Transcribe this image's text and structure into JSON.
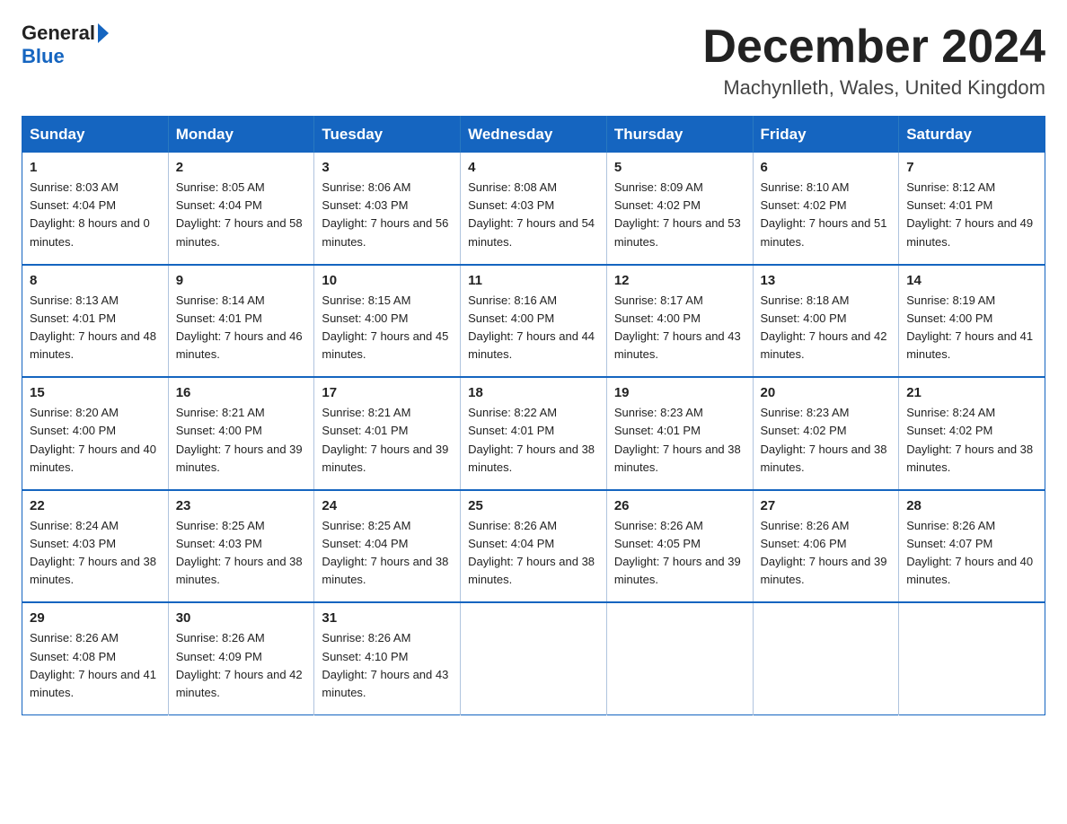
{
  "logo": {
    "general": "General",
    "blue": "Blue"
  },
  "title": "December 2024",
  "location": "Machynlleth, Wales, United Kingdom",
  "days_of_week": [
    "Sunday",
    "Monday",
    "Tuesday",
    "Wednesday",
    "Thursday",
    "Friday",
    "Saturday"
  ],
  "weeks": [
    [
      {
        "day": "1",
        "sunrise": "8:03 AM",
        "sunset": "4:04 PM",
        "daylight": "8 hours and 0 minutes."
      },
      {
        "day": "2",
        "sunrise": "8:05 AM",
        "sunset": "4:04 PM",
        "daylight": "7 hours and 58 minutes."
      },
      {
        "day": "3",
        "sunrise": "8:06 AM",
        "sunset": "4:03 PM",
        "daylight": "7 hours and 56 minutes."
      },
      {
        "day": "4",
        "sunrise": "8:08 AM",
        "sunset": "4:03 PM",
        "daylight": "7 hours and 54 minutes."
      },
      {
        "day": "5",
        "sunrise": "8:09 AM",
        "sunset": "4:02 PM",
        "daylight": "7 hours and 53 minutes."
      },
      {
        "day": "6",
        "sunrise": "8:10 AM",
        "sunset": "4:02 PM",
        "daylight": "7 hours and 51 minutes."
      },
      {
        "day": "7",
        "sunrise": "8:12 AM",
        "sunset": "4:01 PM",
        "daylight": "7 hours and 49 minutes."
      }
    ],
    [
      {
        "day": "8",
        "sunrise": "8:13 AM",
        "sunset": "4:01 PM",
        "daylight": "7 hours and 48 minutes."
      },
      {
        "day": "9",
        "sunrise": "8:14 AM",
        "sunset": "4:01 PM",
        "daylight": "7 hours and 46 minutes."
      },
      {
        "day": "10",
        "sunrise": "8:15 AM",
        "sunset": "4:00 PM",
        "daylight": "7 hours and 45 minutes."
      },
      {
        "day": "11",
        "sunrise": "8:16 AM",
        "sunset": "4:00 PM",
        "daylight": "7 hours and 44 minutes."
      },
      {
        "day": "12",
        "sunrise": "8:17 AM",
        "sunset": "4:00 PM",
        "daylight": "7 hours and 43 minutes."
      },
      {
        "day": "13",
        "sunrise": "8:18 AM",
        "sunset": "4:00 PM",
        "daylight": "7 hours and 42 minutes."
      },
      {
        "day": "14",
        "sunrise": "8:19 AM",
        "sunset": "4:00 PM",
        "daylight": "7 hours and 41 minutes."
      }
    ],
    [
      {
        "day": "15",
        "sunrise": "8:20 AM",
        "sunset": "4:00 PM",
        "daylight": "7 hours and 40 minutes."
      },
      {
        "day": "16",
        "sunrise": "8:21 AM",
        "sunset": "4:00 PM",
        "daylight": "7 hours and 39 minutes."
      },
      {
        "day": "17",
        "sunrise": "8:21 AM",
        "sunset": "4:01 PM",
        "daylight": "7 hours and 39 minutes."
      },
      {
        "day": "18",
        "sunrise": "8:22 AM",
        "sunset": "4:01 PM",
        "daylight": "7 hours and 38 minutes."
      },
      {
        "day": "19",
        "sunrise": "8:23 AM",
        "sunset": "4:01 PM",
        "daylight": "7 hours and 38 minutes."
      },
      {
        "day": "20",
        "sunrise": "8:23 AM",
        "sunset": "4:02 PM",
        "daylight": "7 hours and 38 minutes."
      },
      {
        "day": "21",
        "sunrise": "8:24 AM",
        "sunset": "4:02 PM",
        "daylight": "7 hours and 38 minutes."
      }
    ],
    [
      {
        "day": "22",
        "sunrise": "8:24 AM",
        "sunset": "4:03 PM",
        "daylight": "7 hours and 38 minutes."
      },
      {
        "day": "23",
        "sunrise": "8:25 AM",
        "sunset": "4:03 PM",
        "daylight": "7 hours and 38 minutes."
      },
      {
        "day": "24",
        "sunrise": "8:25 AM",
        "sunset": "4:04 PM",
        "daylight": "7 hours and 38 minutes."
      },
      {
        "day": "25",
        "sunrise": "8:26 AM",
        "sunset": "4:04 PM",
        "daylight": "7 hours and 38 minutes."
      },
      {
        "day": "26",
        "sunrise": "8:26 AM",
        "sunset": "4:05 PM",
        "daylight": "7 hours and 39 minutes."
      },
      {
        "day": "27",
        "sunrise": "8:26 AM",
        "sunset": "4:06 PM",
        "daylight": "7 hours and 39 minutes."
      },
      {
        "day": "28",
        "sunrise": "8:26 AM",
        "sunset": "4:07 PM",
        "daylight": "7 hours and 40 minutes."
      }
    ],
    [
      {
        "day": "29",
        "sunrise": "8:26 AM",
        "sunset": "4:08 PM",
        "daylight": "7 hours and 41 minutes."
      },
      {
        "day": "30",
        "sunrise": "8:26 AM",
        "sunset": "4:09 PM",
        "daylight": "7 hours and 42 minutes."
      },
      {
        "day": "31",
        "sunrise": "8:26 AM",
        "sunset": "4:10 PM",
        "daylight": "7 hours and 43 minutes."
      },
      null,
      null,
      null,
      null
    ]
  ]
}
